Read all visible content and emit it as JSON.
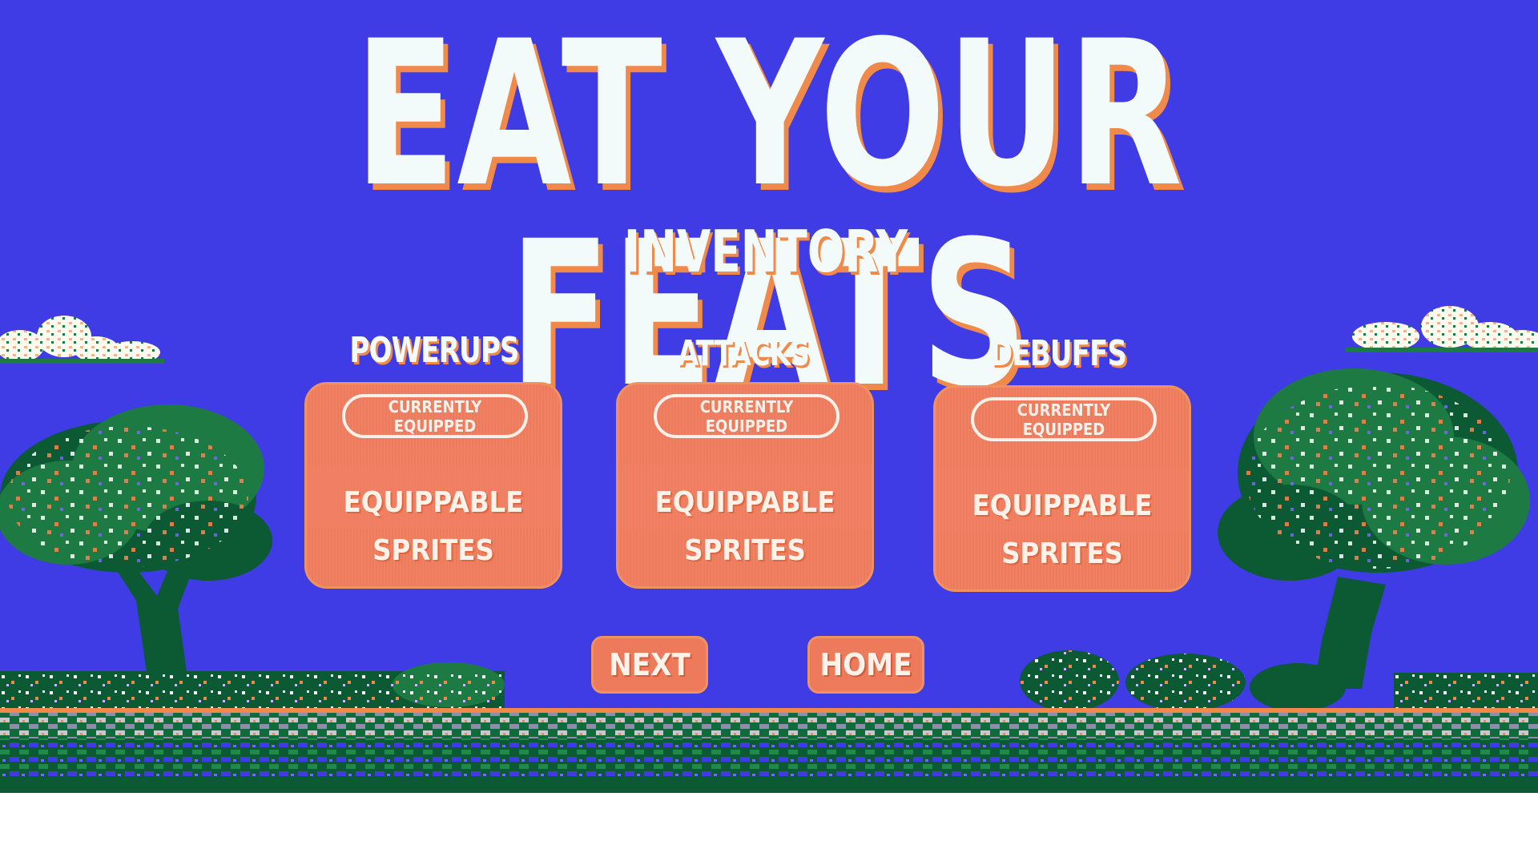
{
  "game": {
    "title": "Eat Your Feats"
  },
  "screen": {
    "title": "Inventory"
  },
  "panels": [
    {
      "heading": "Powerups",
      "equipped_label": "Currently Equipped",
      "slot_label": "Equippable Sprites"
    },
    {
      "heading": "Attacks",
      "equipped_label": "Currently Equipped",
      "slot_label": "Equippable Sprites"
    },
    {
      "heading": "Debuffs",
      "equipped_label": "Currently Equipped",
      "slot_label": "Equippable Sprites"
    }
  ],
  "nav": {
    "next_label": "Next",
    "home_label": "Home"
  },
  "colors": {
    "sky": "#3f3ce6",
    "title_text": "#f3fafa",
    "title_shadow": "#ef8a4a",
    "panel": "#ee7a5c",
    "foliage_dark": "#0b5a34",
    "foliage_mid": "#1d7a43"
  }
}
